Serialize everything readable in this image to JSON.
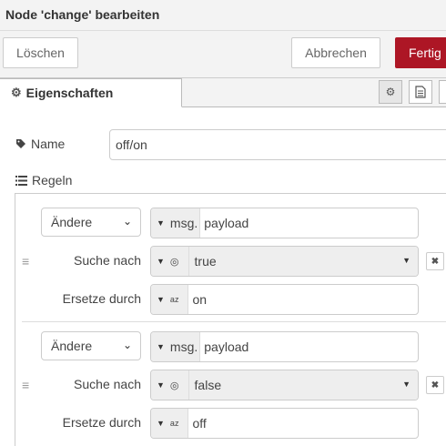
{
  "window": {
    "title": "Node 'change' bearbeiten"
  },
  "toolbar": {
    "delete_label": "Löschen",
    "cancel_label": "Abbrechen",
    "done_label": "Fertig"
  },
  "tabs": {
    "properties_label": "Eigenschaften",
    "icons": [
      "gear-icon",
      "document-icon",
      "more-icon"
    ]
  },
  "form": {
    "name_label": "Name",
    "name_value": "off/on",
    "rules_label": "Regeln"
  },
  "rules": [
    {
      "action": "Ändere",
      "target_type": "msg.",
      "target_value": "payload",
      "search_label": "Suche nach",
      "search_value": "true",
      "replace_label": "Ersetze durch",
      "replace_value": "on"
    },
    {
      "action": "Ändere",
      "target_type": "msg.",
      "target_value": "payload",
      "search_label": "Suche nach",
      "search_value": "false",
      "replace_label": "Ersetze durch",
      "replace_value": "off"
    }
  ],
  "colors": {
    "primary_button": "#ad1625",
    "background_bar": "#f3f3f3",
    "border": "#cccccc"
  }
}
